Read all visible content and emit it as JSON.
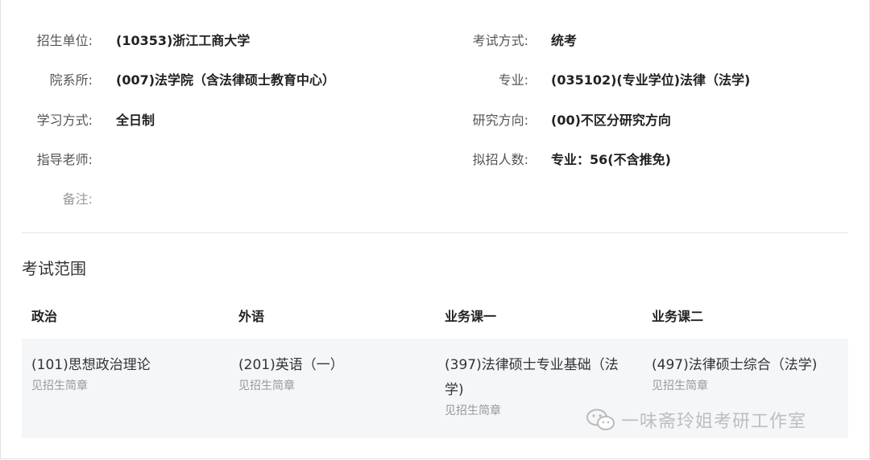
{
  "info": {
    "left": [
      {
        "label": "招生单位:",
        "value": "(10353)浙江工商大学"
      },
      {
        "label": "院系所:",
        "value": "(007)法学院（含法律硕士教育中心）"
      },
      {
        "label": "学习方式:",
        "value": "全日制"
      },
      {
        "label": "指导老师:",
        "value": ""
      },
      {
        "label": "备注:",
        "value": ""
      }
    ],
    "right": [
      {
        "label": "考试方式:",
        "value": "统考"
      },
      {
        "label": "专业:",
        "value": "(035102)(专业学位)法律（法学)"
      },
      {
        "label": "研究方向:",
        "value": "(00)不区分研究方向"
      },
      {
        "label": "拟招人数:",
        "value": "专业：56(不含推免)"
      }
    ]
  },
  "scope": {
    "title": "考试范围",
    "headers": [
      "政治",
      "外语",
      "业务课一",
      "业务课二"
    ],
    "cells": [
      {
        "name": "(101)思想政治理论",
        "note": "见招生简章"
      },
      {
        "name": "(201)英语（一）",
        "note": "见招生简章"
      },
      {
        "name": "(397)法律硕士专业基础（法学)",
        "note": "见招生简章"
      },
      {
        "name": "(497)法律硕士综合（法学)",
        "note": "见招生简章"
      }
    ]
  },
  "watermark": {
    "text": "一味斋玲姐考研工作室",
    "icon": "wechat-icon"
  }
}
